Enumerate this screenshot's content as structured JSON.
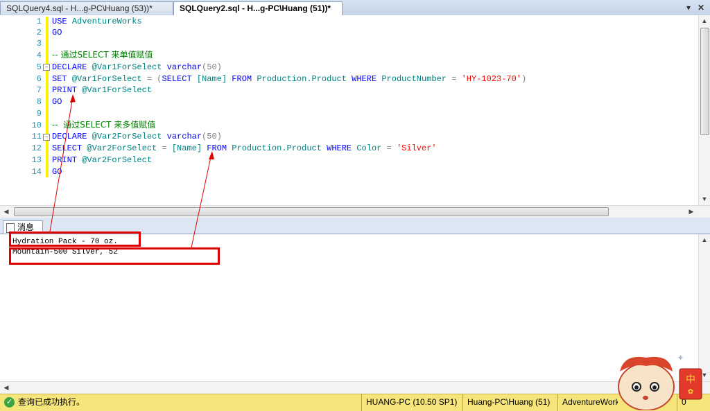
{
  "tabs": [
    {
      "label": "SQLQuery4.sql - H...g-PC\\Huang (53))*",
      "active": false
    },
    {
      "label": "SQLQuery2.sql - H...g-PC\\Huang (51))*",
      "active": true
    }
  ],
  "tabbar_icons": [
    "dropdown-icon",
    "close-icon"
  ],
  "line_numbers": [
    "1",
    "2",
    "3",
    "4",
    "5",
    "6",
    "7",
    "8",
    "9",
    "10",
    "11",
    "12",
    "13",
    "14"
  ],
  "code": {
    "l1": {
      "kw": "USE",
      "rest": "AdventureWorks"
    },
    "l2": {
      "kw": "GO"
    },
    "l4": {
      "comment": "-- 通过SELECT 来单值赋值"
    },
    "l5": {
      "kw": "DECLARE",
      "var": "@Var1ForSelect",
      "type": "varchar",
      "size": "(50)"
    },
    "l6": {
      "set": "SET",
      "var": "@Var1ForSelect",
      "eq": "=",
      "paren": "(",
      "select": "SELECT",
      "col": "[Name]",
      "from": "FROM",
      "table": "Production.Product",
      "where": "WHERE",
      "wcol": "ProductNumber",
      "eq2": "=",
      "lit": "'HY-1023-70'",
      "close": ")"
    },
    "l7": {
      "kw": "PRINT",
      "var": "@Var1ForSelect"
    },
    "l8": {
      "kw": "GO"
    },
    "l10": {
      "comment": "--  通过SELECT 来多值赋值"
    },
    "l11": {
      "kw": "DECLARE",
      "var": "@Var2ForSelect",
      "type": "varchar",
      "size": "(50)"
    },
    "l12": {
      "select": "SELECT",
      "var": "@Var2ForSelect",
      "eq": "=",
      "col": "[Name]",
      "from": "FROM",
      "table": "Production.Product",
      "where": "WHERE",
      "wcol": "Color",
      "eq2": "=",
      "lit": "'Silver'"
    },
    "l13": {
      "kw": "PRINT",
      "var": "@Var2ForSelect"
    },
    "l14": {
      "kw": "GO"
    }
  },
  "messages_tab": {
    "label": "消息"
  },
  "messages": [
    "Hydration Pack - 70 oz.",
    "Mountain-500 Silver, 52"
  ],
  "status": {
    "text": "查询已成功执行。",
    "server": "HUANG-PC (10.50 SP1)",
    "user": "Huang-PC\\Huang (51)",
    "database": "AdventureWorks",
    "rows": "0"
  },
  "colors": {
    "keyword": "#0000ff",
    "comment": "#008000",
    "string": "#ff0000",
    "status_bar": "#f6e57a",
    "annotation": "#e00000"
  }
}
